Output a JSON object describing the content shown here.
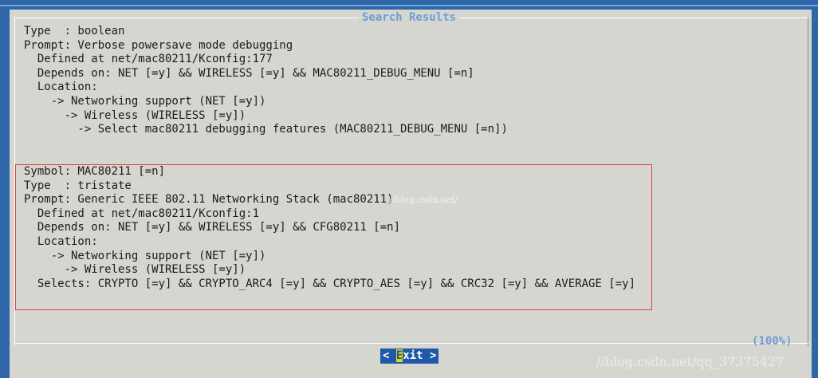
{
  "dialog": {
    "title": "Search Results",
    "percent": "(100%)"
  },
  "lines": [
    "Type  : boolean",
    "Prompt: Verbose powersave mode debugging",
    "  Defined at net/mac80211/Kconfig:177",
    "  Depends on: NET [=y] && WIRELESS [=y] && MAC80211_DEBUG_MENU [=n]",
    "  Location:",
    "    -> Networking support (NET [=y])",
    "      -> Wireless (WIRELESS [=y])",
    "        -> Select mac80211 debugging features (MAC80211_DEBUG_MENU [=n])",
    "",
    "",
    "Symbol: MAC80211 [=n]",
    "Type  : tristate",
    "Prompt: Generic IEEE 802.11 Networking Stack (mac80211)",
    "  Defined at net/mac80211/Kconfig:1",
    "  Depends on: NET [=y] && WIRELESS [=y] && CFG80211 [=n]",
    "  Location:",
    "    -> Networking support (NET [=y])",
    "      -> Wireless (WIRELESS [=y])",
    "  Selects: CRYPTO [=y] && CRYPTO_ARC4 [=y] && CRYPTO_AES [=y] && CRC32 [=y] && AVERAGE [=y]"
  ],
  "exit_button": {
    "left_bracket": "< ",
    "hotkey": "E",
    "rest": "xit",
    "right_bracket": " >"
  },
  "watermark": "//blog.csdn.net/qq_37375427",
  "watermark_mid": "//blog.csdn.net/",
  "colors": {
    "backdrop": "#2f66a8",
    "dialog": "#d6d6d0",
    "title": "#6b9fd6",
    "button": "#1e5aa8",
    "hotkey": "#f2d600",
    "highlight_box": "#e04040"
  }
}
